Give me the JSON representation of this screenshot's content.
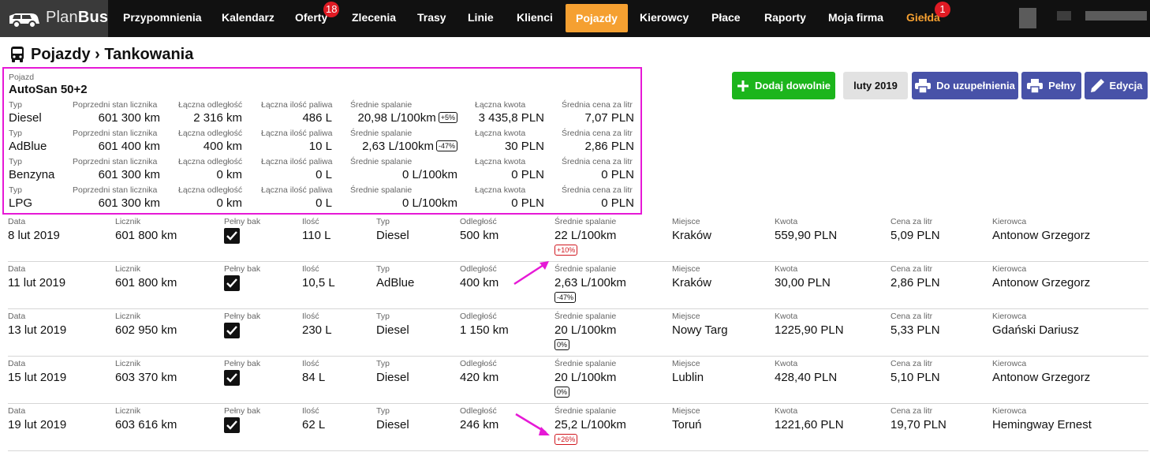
{
  "nav": {
    "logo_plan": "Plan",
    "logo_bus": "Bus",
    "items": [
      {
        "label": "Przypomnienia"
      },
      {
        "label": "Kalendarz"
      },
      {
        "label": "Oferty",
        "badge": "18"
      },
      {
        "label": "Zlecenia"
      },
      {
        "label": "Trasy"
      },
      {
        "label": "Linie"
      },
      {
        "label": "Klienci"
      },
      {
        "label": "Pojazdy",
        "active": true
      },
      {
        "label": "Kierowcy"
      },
      {
        "label": "Płace"
      },
      {
        "label": "Raporty"
      },
      {
        "label": "Moja firma"
      },
      {
        "label": "Giełda",
        "badge": "1"
      }
    ]
  },
  "page": {
    "title": "Pojazdy › Tankowania"
  },
  "summary": {
    "vehicle_label": "Pojazd",
    "vehicle_name": "AutoSan 50+2",
    "labels": {
      "type": "Typ",
      "prev_odometer": "Poprzedni stan licznika",
      "total_distance": "Łączna odległość",
      "total_fuel": "Łączna ilość paliwa",
      "avg_consumption": "Średnie spalanie",
      "total_amount": "Łączna kwota",
      "avg_price": "Średnia cena za litr"
    },
    "rows": [
      {
        "type": "Diesel",
        "prev_odometer": "601 300 km",
        "total_distance": "2 316 km",
        "total_fuel": "486 L",
        "avg_consumption": "20,98 L/100km",
        "pct": "+5%",
        "pct_red": false,
        "total_amount": "3 435,8 PLN",
        "avg_price": "7,07 PLN"
      },
      {
        "type": "AdBlue",
        "prev_odometer": "601 400 km",
        "total_distance": "400 km",
        "total_fuel": "10 L",
        "avg_consumption": "2,63 L/100km",
        "pct": "-47%",
        "pct_red": false,
        "total_amount": "30 PLN",
        "avg_price": "2,86 PLN"
      },
      {
        "type": "Benzyna",
        "prev_odometer": "601 300 km",
        "total_distance": "0 km",
        "total_fuel": "0 L",
        "avg_consumption": "0 L/100km",
        "pct": "",
        "pct_red": false,
        "total_amount": "0 PLN",
        "avg_price": "0 PLN"
      },
      {
        "type": "LPG",
        "prev_odometer": "601 300 km",
        "total_distance": "0 km",
        "total_fuel": "0 L",
        "avg_consumption": "0 L/100km",
        "pct": "",
        "pct_red": false,
        "total_amount": "0 PLN",
        "avg_price": "0 PLN"
      }
    ]
  },
  "buttons": {
    "add": "Dodaj dowolnie",
    "month": "luty 2019",
    "to_fill": "Do uzupełnienia",
    "full": "Pełny",
    "edit": "Edycja"
  },
  "table": {
    "labels": {
      "date": "Data",
      "odometer": "Licznik",
      "full_tank": "Pełny bak",
      "quantity": "Ilość",
      "type": "Typ",
      "distance": "Odległość",
      "avg_consumption": "Średnie spalanie",
      "place": "Miejsce",
      "amount": "Kwota",
      "price_per_liter": "Cena za litr",
      "driver": "Kierowca"
    },
    "rows": [
      {
        "date": "8 lut 2019",
        "odometer": "601 800 km",
        "full_tank": true,
        "quantity": "110 L",
        "type": "Diesel",
        "distance": "500 km",
        "avg_consumption": "22 L/100km",
        "pct": "+10%",
        "pct_red": true,
        "place": "Kraków",
        "amount": "559,90 PLN",
        "price_per_liter": "5,09 PLN",
        "driver": "Antonow Grzegorz"
      },
      {
        "date": "11 lut 2019",
        "odometer": "601 800 km",
        "full_tank": true,
        "quantity": "10,5 L",
        "type": "AdBlue",
        "distance": "400 km",
        "avg_consumption": "2,63 L/100km",
        "pct": "-47%",
        "pct_red": false,
        "place": "Kraków",
        "amount": "30,00 PLN",
        "price_per_liter": "2,86 PLN",
        "driver": "Antonow Grzegorz"
      },
      {
        "date": "13 lut 2019",
        "odometer": "602 950 km",
        "full_tank": true,
        "quantity": "230 L",
        "type": "Diesel",
        "distance": "1 150 km",
        "avg_consumption": "20 L/100km",
        "pct": "0%",
        "pct_red": false,
        "place": "Nowy Targ",
        "amount": "1225,90 PLN",
        "price_per_liter": "5,33 PLN",
        "driver": "Gdański Dariusz"
      },
      {
        "date": "15 lut 2019",
        "odometer": "603 370 km",
        "full_tank": true,
        "quantity": "84 L",
        "type": "Diesel",
        "distance": "420 km",
        "avg_consumption": "20 L/100km",
        "pct": "0%",
        "pct_red": false,
        "place": "Lublin",
        "amount": "428,40 PLN",
        "price_per_liter": "5,10 PLN",
        "driver": "Antonow Grzegorz"
      },
      {
        "date": "19 lut 2019",
        "odometer": "603 616 km",
        "full_tank": true,
        "quantity": "62 L",
        "type": "Diesel",
        "distance": "246 km",
        "avg_consumption": "25,2 L/100km",
        "pct": "+26%",
        "pct_red": true,
        "place": "Toruń",
        "amount": "1221,60 PLN",
        "price_per_liter": "19,70 PLN",
        "driver": "Hemingway Ernest"
      }
    ]
  },
  "colors": {
    "highlight": "#e619d6",
    "accent_orange": "#f5a031",
    "green": "#1cb51c",
    "blue": "#4852a8",
    "badge_red": "#e01b24",
    "pct_red": "#d0161e"
  }
}
